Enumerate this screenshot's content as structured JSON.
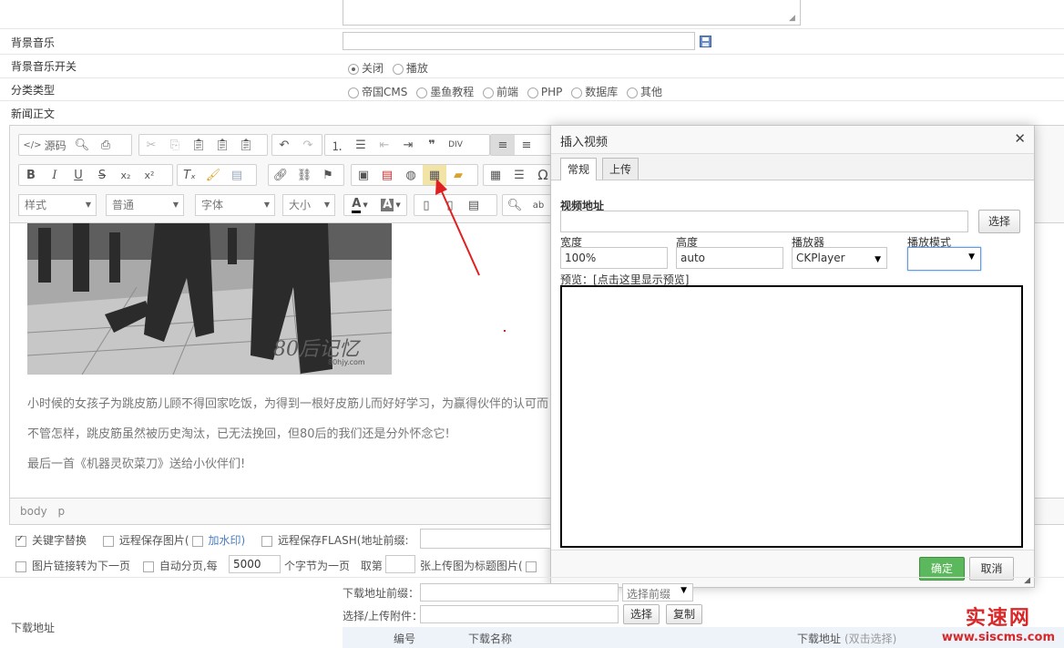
{
  "form": {
    "bg_music_label": "背景音乐",
    "bg_music_switch_label": "背景音乐开关",
    "bg_music_switch_options": [
      "关闭",
      "播放"
    ],
    "category_label": "分类类型",
    "category_options": [
      "帝国CMS",
      "墨鱼教程",
      "前端",
      "PHP",
      "数据库",
      "其他"
    ],
    "news_body_label": "新闻正文"
  },
  "editor": {
    "source_label": "源码",
    "combo_style": "样式",
    "combo_format": "普通",
    "combo_font": "字体",
    "combo_size": "大小",
    "status_path": [
      "body",
      "p"
    ],
    "paragraphs": [
      "小时候的女孩子为跳皮筋儿顾不得回家吃饭，为得到一根好皮筋儿而好好学习，为赢得伙伴的认可而",
      "不管怎样，跳皮筋虽然被历史淘汰，已无法挽回，但80后的我们还是分外怀念它!",
      "最后一首《机器灵砍菜刀》送给小伙伴们!"
    ],
    "photo_watermark": "80后记忆",
    "photo_watermark_sub": "80hjy.com"
  },
  "dialog": {
    "title": "插入视频",
    "close": "✕",
    "tabs": [
      "常规",
      "上传"
    ],
    "url_label": "视频地址",
    "url_value": "",
    "choose_btn": "选择",
    "width_label": "宽度",
    "width_value": "100%",
    "height_label": "高度",
    "height_value": "auto",
    "player_label": "播放器",
    "player_value": "CKPlayer",
    "mode_label": "播放模式",
    "mode_value": "",
    "preview_label": "预览：",
    "preview_link": "[点击这里显示预览]",
    "ok_btn": "确定",
    "cancel_btn": "取消"
  },
  "options": {
    "keyword_replace": "关键字替换",
    "remote_save_img": "远程保存图片(",
    "watermark": "加水印)",
    "remote_save_flash": "远程保存FLASH(地址前缀:",
    "img_link_next": "图片链接转为下一页",
    "auto_page": "自动分页",
    "per": ",每",
    "per_value": "5000",
    "chars_per_page": "个字节为一页",
    "take_nth": "取第",
    "take_value": "",
    "title_img": "张上传图为标题图片(",
    "download_label": "下载地址",
    "download_prefix_label": "下载地址前缀：",
    "download_prefix_select": "选择前缀",
    "upload_attach_label": "选择/上传附件：",
    "choose_btn": "选择",
    "copy_btn": "复制",
    "table_cols": [
      "编号",
      "下载名称",
      "下载地址",
      "(双击选择)"
    ]
  },
  "watermark": {
    "line1": "实速网",
    "line2": "www.siscms.com"
  },
  "colors": {
    "ok_green": "#5cb85c",
    "arrow_red": "#e02020",
    "watermark_red": "#d8282a"
  }
}
